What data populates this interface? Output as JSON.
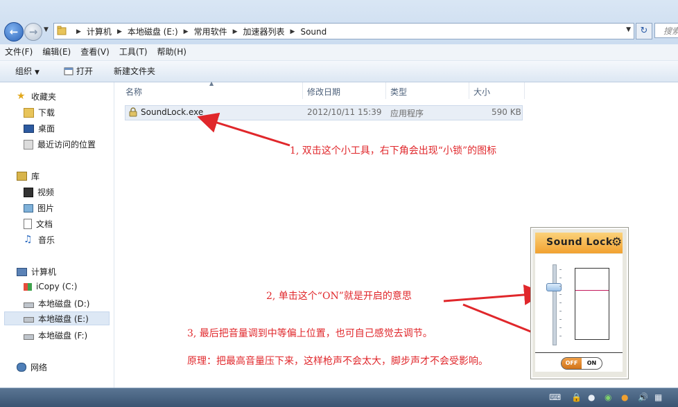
{
  "window": {
    "address": {
      "crumbs": [
        "计算机",
        "本地磁盘 (E:)",
        "常用软件",
        "加速器列表",
        "Sound"
      ]
    },
    "search_placeholder": "搜索 Sound"
  },
  "menu": [
    "文件(F)",
    "编辑(E)",
    "查看(V)",
    "工具(T)",
    "帮助(H)"
  ],
  "commands": {
    "organize": "组织",
    "open": "打开",
    "new_folder": "新建文件夹"
  },
  "nav": {
    "favorites": {
      "label": "收藏夹",
      "items": [
        "下载",
        "桌面",
        "最近访问的位置"
      ]
    },
    "libraries": {
      "label": "库",
      "items": [
        "视频",
        "图片",
        "文档",
        "音乐"
      ]
    },
    "computer": {
      "label": "计算机",
      "items": [
        "iCopy (C:)",
        "本地磁盘 (D:)",
        "本地磁盘 (E:)",
        "本地磁盘 (F:)"
      ]
    },
    "network": {
      "label": "网络"
    }
  },
  "columns": {
    "name": "名称",
    "modified": "修改日期",
    "type": "类型",
    "size": "大小"
  },
  "file": {
    "name": "SoundLock.exe",
    "modified": "2012/10/11 15:39",
    "type": "应用程序",
    "size": "590 KB"
  },
  "annotations": {
    "step1": "1, 双击这个小工具，右下角会出现“小锁”的图标",
    "step2": "2, 单击这个“ON”就是开启的意思",
    "step3": "3, 最后把音量调到中等偏上位置，也可自己感觉去调节。",
    "principle": "原理：把最高音量压下来，这样枪声不会太大，脚步声才不会受影响。"
  },
  "soundlock": {
    "title": "Sound Lock",
    "off_label": "OFF",
    "on_label": "ON",
    "slider_level": 0.72
  },
  "colors": {
    "annotation": "#e0272b",
    "accent": "#f1a130"
  }
}
